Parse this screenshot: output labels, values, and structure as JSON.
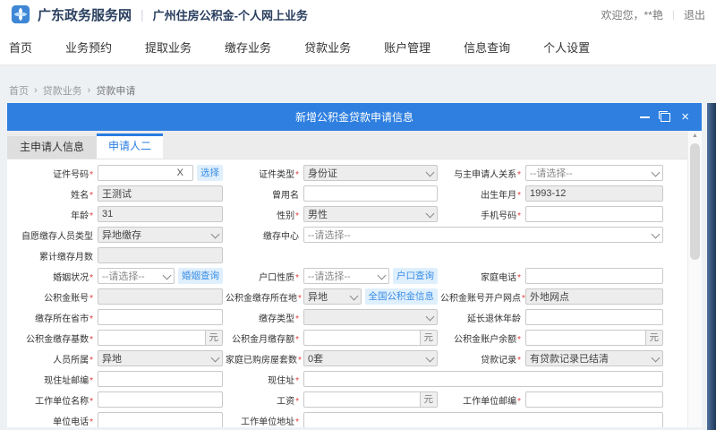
{
  "header": {
    "brand": "广东政务服务网",
    "app_title": "广州住房公积金-个人网上业务",
    "welcome": "欢迎您，**艳",
    "logout": "退出"
  },
  "nav": {
    "items": [
      "首页",
      "业务预约",
      "提取业务",
      "缴存业务",
      "贷款业务",
      "账户管理",
      "信息查询",
      "个人设置"
    ]
  },
  "breadcrumb": {
    "items": [
      "首页",
      "贷款业务",
      "贷款申请"
    ],
    "sep": "›"
  },
  "modal": {
    "title": "新增公积金贷款申请信息",
    "tabs": {
      "main": "主申请人信息",
      "second": "申请人二"
    },
    "scroll_up_arrow": "▲"
  },
  "form": {
    "units": {
      "yuan": "元"
    },
    "fields": {
      "cert_no": {
        "label": "证件号码",
        "req": "*",
        "value": "",
        "suffix": "X",
        "button": "选择"
      },
      "cert_type": {
        "label": "证件类型",
        "req": "*",
        "value": "身份证"
      },
      "relation": {
        "label": "与主申请人关系",
        "req": "*",
        "value": "--请选择--"
      },
      "name": {
        "label": "姓名",
        "req": "*",
        "value": "王测试"
      },
      "former_name": {
        "label": "曾用名",
        "value": ""
      },
      "birth": {
        "label": "出生年月",
        "req": "*",
        "value": "1993-12"
      },
      "age": {
        "label": "年龄",
        "req": "*",
        "value": "31"
      },
      "gender": {
        "label": "性别",
        "req": "*",
        "value": "男性"
      },
      "mobile": {
        "label": "手机号码",
        "req": "*",
        "value": ""
      },
      "voluntary_type": {
        "label": "自愿缴存人员类型",
        "value": "异地缴存"
      },
      "deposit_center": {
        "label": "缴存中心",
        "value": "--请选择--"
      },
      "total_months": {
        "label": "累计缴存月数",
        "value": ""
      },
      "marital": {
        "label": "婚姻状况",
        "req": "*",
        "value": "--请选择--",
        "button": "婚姻查询"
      },
      "hukou": {
        "label": "户口性质",
        "req": "*",
        "value": "--请选择--",
        "button": "户口查询"
      },
      "home_phone": {
        "label": "家庭电话",
        "req": "*",
        "value": ""
      },
      "fund_account": {
        "label": "公积金账号",
        "req": "*",
        "value": ""
      },
      "fund_location": {
        "label": "公积金缴存所在地",
        "req": "*",
        "value": "异地",
        "button": "全国公积金信息"
      },
      "fund_branch": {
        "label": "公积金账号开户网点",
        "req": "*",
        "value": "外地网点"
      },
      "deposit_province": {
        "label": "缴存所在省市",
        "req": "*",
        "value": ""
      },
      "deposit_type": {
        "label": "缴存类型",
        "req": "*",
        "value": ""
      },
      "retire_extend": {
        "label": "延长退休年龄",
        "value": ""
      },
      "fund_base": {
        "label": "公积金缴存基数",
        "req": "*",
        "value": ""
      },
      "fund_monthly": {
        "label": "公积金月缴存额",
        "req": "*",
        "value": ""
      },
      "fund_balance": {
        "label": "公积金账户余额",
        "req": "*",
        "value": ""
      },
      "person_belong": {
        "label": "人员所属",
        "req": "*",
        "value": "异地"
      },
      "houses_owned": {
        "label": "家庭已购房屋套数",
        "req": "*",
        "value": "0套"
      },
      "loan_record": {
        "label": "贷款记录",
        "req": "*",
        "value": "有贷款记录已结清"
      },
      "addr_zip": {
        "label": "现住址邮编",
        "req": "*",
        "value": ""
      },
      "address": {
        "label": "现住址",
        "req": "*",
        "value": ""
      },
      "employer": {
        "label": "工作单位名称",
        "req": "*",
        "value": ""
      },
      "salary": {
        "label": "工资",
        "req": "*",
        "value": ""
      },
      "employer_zip": {
        "label": "工作单位邮编",
        "req": "*",
        "value": ""
      },
      "unit_phone": {
        "label": "单位电话",
        "req": "*",
        "value": ""
      },
      "employer_addr": {
        "label": "工作单位地址",
        "req": "*",
        "value": ""
      }
    }
  },
  "colors": {
    "accent": "#2e7fe0",
    "tab_active": "#2a7de1",
    "lite_button_bg": "#dfeffc",
    "lite_button_text": "#3a8ee6",
    "required_star": "#e23b3b",
    "disabled_bg": "#ededed",
    "edge_strip": "#1d3757"
  }
}
